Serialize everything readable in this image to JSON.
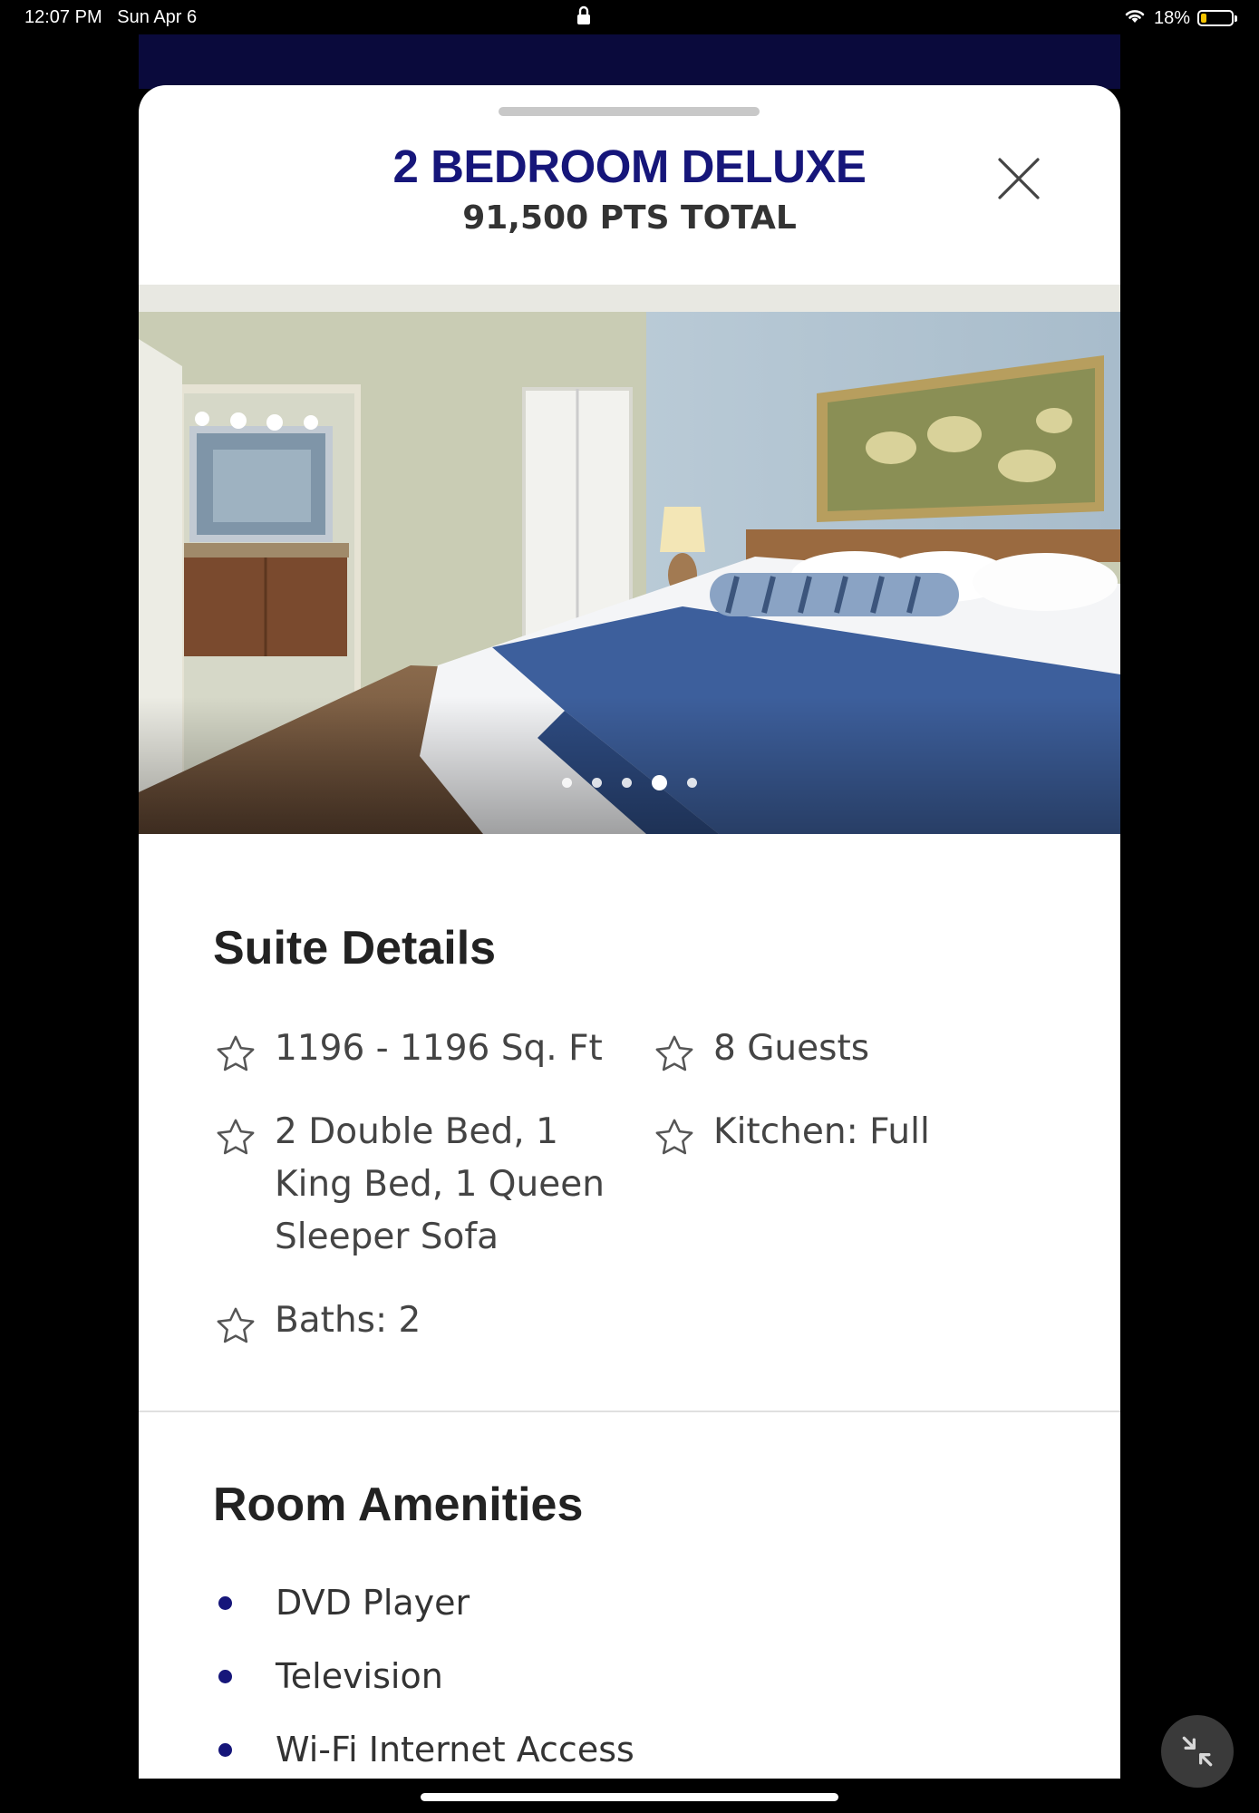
{
  "status_bar": {
    "time": "12:07 PM",
    "date": "Sun Apr 6",
    "battery": "18%",
    "battery_level": 0.18
  },
  "modal": {
    "title": "2 BEDROOM DELUXE",
    "subtitle": "91,500 PTS TOTAL",
    "close_icon": "close-icon"
  },
  "carousel": {
    "slide_count": 5,
    "active_index": 3
  },
  "suite_details": {
    "heading": "Suite Details",
    "items": [
      {
        "text": "1196 - 1196 Sq. Ft",
        "icon": "star-icon"
      },
      {
        "text": "8 Guests",
        "icon": "star-icon"
      },
      {
        "text": "2 Double Bed, 1 King Bed, 1 Queen Sleeper Sofa",
        "icon": "star-icon"
      },
      {
        "text": "Kitchen: Full",
        "icon": "star-icon"
      },
      {
        "text": "Baths: 2",
        "icon": "star-icon"
      }
    ]
  },
  "room_amenities": {
    "heading": "Room Amenities",
    "items": [
      "DVD Player",
      "Television",
      "Wi-Fi Internet Access"
    ]
  },
  "colors": {
    "brand_navy": "#16167a",
    "backdrop": "#0a0a3c"
  }
}
